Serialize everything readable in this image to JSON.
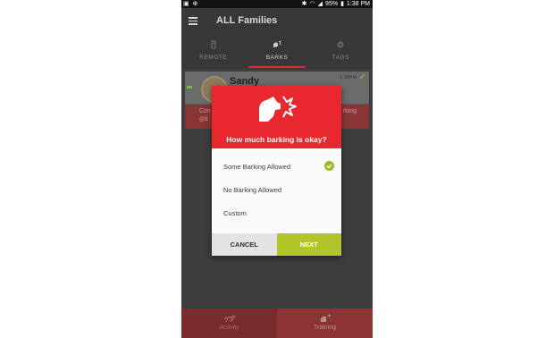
{
  "status_bar": {
    "battery": "95%",
    "time": "1:38 PM"
  },
  "app_bar": {
    "title": "ALL Families"
  },
  "tabs": [
    {
      "label": "REMOTE",
      "active": false
    },
    {
      "label": "BARKS",
      "active": true
    },
    {
      "label": "TAGS",
      "active": false
    }
  ],
  "card": {
    "name": "Sandy",
    "time": "1:38PM",
    "left_text": "Con",
    "left_text2": "@8",
    "right_text": "rking"
  },
  "dialog": {
    "title": "How much barking is okay?",
    "options": [
      {
        "label": "Some Barking Allowed",
        "selected": true
      },
      {
        "label": "No Barking Allowed",
        "selected": false
      },
      {
        "label": "Custom",
        "selected": false
      }
    ],
    "cancel_label": "CANCEL",
    "next_label": "NEXT"
  },
  "bottom_nav": [
    {
      "label": "Activity"
    },
    {
      "label": "Training"
    }
  ],
  "colors": {
    "header_red": "#e8282e",
    "next_green": "#b3c42b",
    "check_green": "#9bbb2a"
  }
}
